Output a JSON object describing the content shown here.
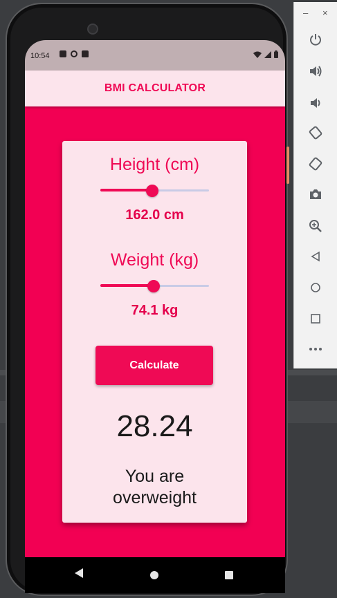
{
  "status_bar": {
    "time": "10:54"
  },
  "app_bar": {
    "title": "BMI CALCULATOR"
  },
  "height": {
    "label": "Height (cm)",
    "value_text": "162.0 cm",
    "slider_fraction": 0.48
  },
  "weight": {
    "label": "Weight (kg)",
    "value_text": "74.1 kg",
    "slider_fraction": 0.49
  },
  "calculate_button": {
    "label": "Calculate"
  },
  "result": {
    "bmi": "28.24",
    "message": "You are overweight"
  },
  "emulator_toolbar": {
    "minimize": "–",
    "close": "×",
    "buttons": [
      "power-icon",
      "volume-up-icon",
      "volume-down-icon",
      "rotate-left-icon",
      "rotate-right-icon",
      "screenshot-icon",
      "zoom-icon",
      "back-icon",
      "home-icon",
      "overview-icon",
      "more-icon"
    ]
  },
  "colors": {
    "accent": "#ef0a55",
    "background": "#f20053",
    "card": "#fce4ec",
    "status_bar": "#c0afb2",
    "slider_inactive": "#c8cbe6"
  }
}
